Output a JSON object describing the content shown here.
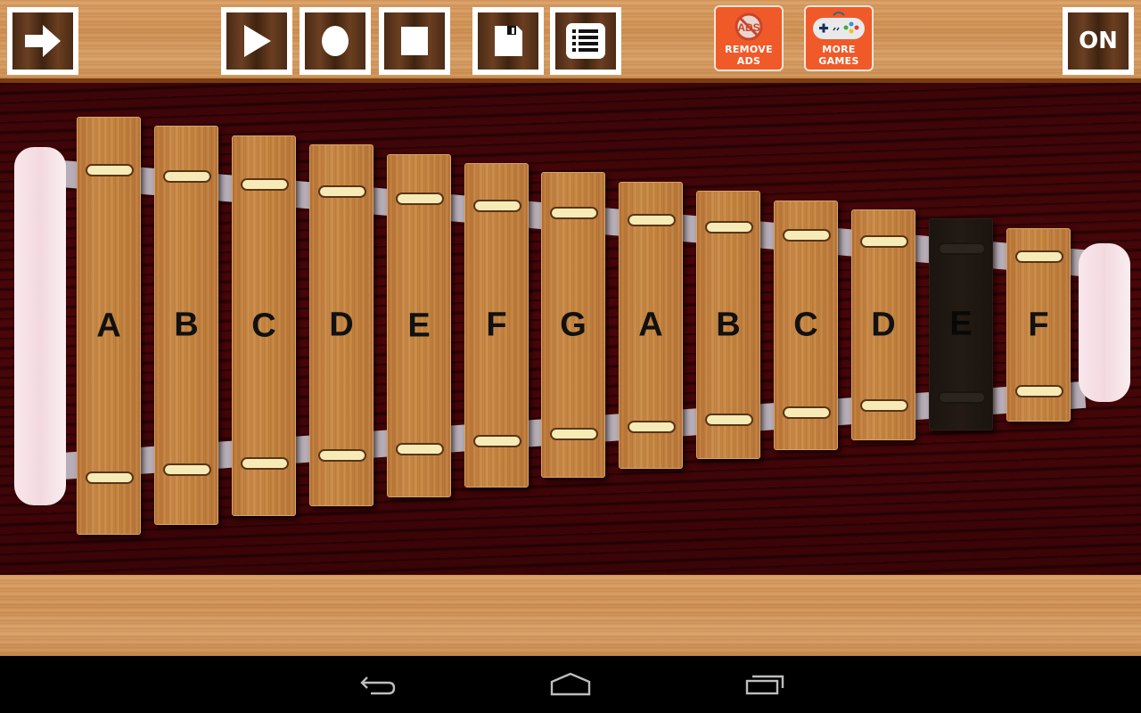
{
  "app": "Xylophone",
  "toolbar": {
    "forward_button": {
      "icon": "arrow-right-icon"
    },
    "play_button": {
      "icon": "play-icon"
    },
    "record_button": {
      "icon": "record-icon"
    },
    "stop_button": {
      "icon": "stop-icon"
    },
    "save_button": {
      "icon": "floppy-disk-icon"
    },
    "list_button": {
      "icon": "list-icon"
    },
    "remove_ads": {
      "line1": "REMOVE",
      "line2": "ADS",
      "icon_text": "ADS"
    },
    "more_games": {
      "line1": "MORE",
      "line2": "GAMES"
    },
    "power_toggle": {
      "label": "ON"
    }
  },
  "xylophone": {
    "bars": [
      {
        "note": "A",
        "active": false
      },
      {
        "note": "B",
        "active": false
      },
      {
        "note": "C",
        "active": false
      },
      {
        "note": "D",
        "active": false
      },
      {
        "note": "E",
        "active": false
      },
      {
        "note": "F",
        "active": false
      },
      {
        "note": "G",
        "active": false
      },
      {
        "note": "A",
        "active": false
      },
      {
        "note": "B",
        "active": false
      },
      {
        "note": "C",
        "active": false
      },
      {
        "note": "D",
        "active": false
      },
      {
        "note": "E",
        "active": true
      },
      {
        "note": "F",
        "active": false
      }
    ]
  },
  "colors": {
    "ad_button": "#f05a28",
    "stage": "#3d0508",
    "bar_wood": "#c48440",
    "bar_pressed": "#1f1812"
  },
  "system_nav": {
    "back": "back-icon",
    "home": "home-icon",
    "recents": "recents-icon"
  }
}
